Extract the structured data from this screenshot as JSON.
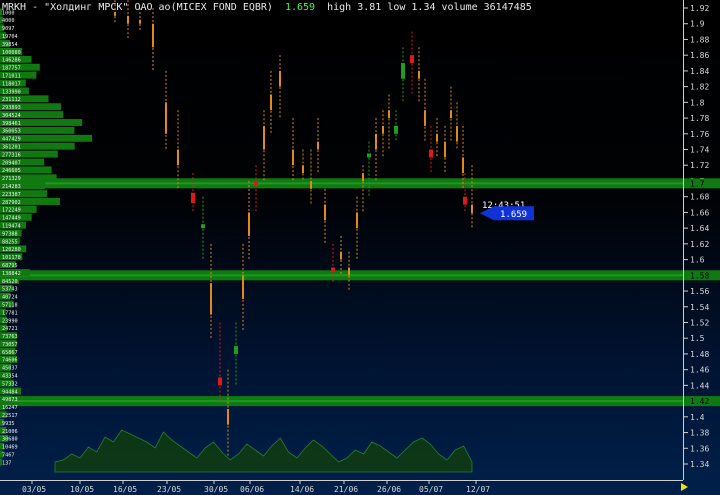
{
  "header": {
    "title": "MRKH - \"Холдинг МРСК\" ОАО ао(MICEX FOND EQBR)",
    "last": "1.659",
    "stats": "high 3.81  low 1.34  volume 36147485"
  },
  "chart_data": [
    {
      "type": "candlestick",
      "y_axis_labels": [
        "1.92",
        "1.9",
        "1.88",
        "1.86",
        "1.84",
        "1.82",
        "1.8",
        "1.78",
        "1.76",
        "1.74",
        "1.72",
        "1.7",
        "1.68",
        "1.66",
        "1.64",
        "1.62",
        "1.6",
        "1.58",
        "1.56",
        "1.54",
        "1.52",
        "1.5",
        "1.48",
        "1.46",
        "1.44",
        "1.42",
        "1.4",
        "1.38",
        "1.36",
        "1.34"
      ],
      "ylim": [
        1.333,
        1.925
      ],
      "x_tick_labels": [
        "03/05",
        "10/05",
        "16/05",
        "23/05",
        "30/05",
        "06/06",
        "14/06",
        "21/06",
        "26/06",
        "05/07",
        "12/07"
      ],
      "bars": [
        {
          "x": 115,
          "low": 1.9,
          "high": 1.93,
          "open": 1.915,
          "close": 1.91,
          "color": "orange"
        },
        {
          "x": 128,
          "low": 1.88,
          "high": 1.93,
          "open": 1.91,
          "close": 1.9,
          "color": "orange"
        },
        {
          "x": 140,
          "low": 1.89,
          "high": 1.92,
          "open": 1.905,
          "close": 1.9,
          "color": "orange"
        },
        {
          "x": 153,
          "low": 1.84,
          "high": 1.92,
          "open": 1.9,
          "close": 1.87,
          "color": "orange"
        },
        {
          "x": 166,
          "low": 1.74,
          "high": 1.84,
          "open": 1.8,
          "close": 1.76,
          "color": "orange"
        },
        {
          "x": 178,
          "low": 1.69,
          "high": 1.79,
          "open": 1.74,
          "close": 1.72,
          "color": "orange"
        },
        {
          "x": 193,
          "low": 1.66,
          "high": 1.71,
          "open": 1.685,
          "close": 1.672,
          "color": "red"
        },
        {
          "x": 203,
          "low": 1.6,
          "high": 1.68,
          "open": 1.645,
          "close": 1.64,
          "color": "green"
        },
        {
          "x": 211,
          "low": 1.5,
          "high": 1.62,
          "open": 1.57,
          "close": 1.53,
          "color": "orange"
        },
        {
          "x": 220,
          "low": 1.42,
          "high": 1.52,
          "open": 1.45,
          "close": 1.44,
          "color": "red"
        },
        {
          "x": 228,
          "low": 1.35,
          "high": 1.46,
          "open": 1.41,
          "close": 1.39,
          "color": "orange"
        },
        {
          "x": 236,
          "low": 1.44,
          "high": 1.52,
          "open": 1.48,
          "close": 1.49,
          "color": "green"
        },
        {
          "x": 243,
          "low": 1.51,
          "high": 1.62,
          "open": 1.55,
          "close": 1.58,
          "color": "orange"
        },
        {
          "x": 249,
          "low": 1.6,
          "high": 1.7,
          "open": 1.63,
          "close": 1.66,
          "color": "orange"
        },
        {
          "x": 256,
          "low": 1.66,
          "high": 1.72,
          "open": 1.7,
          "close": 1.694,
          "color": "red"
        },
        {
          "x": 264,
          "low": 1.7,
          "high": 1.79,
          "open": 1.74,
          "close": 1.77,
          "color": "orange"
        },
        {
          "x": 271,
          "low": 1.76,
          "high": 1.84,
          "open": 1.79,
          "close": 1.81,
          "color": "orange"
        },
        {
          "x": 280,
          "low": 1.78,
          "high": 1.86,
          "open": 1.82,
          "close": 1.84,
          "color": "orange"
        },
        {
          "x": 293,
          "low": 1.7,
          "high": 1.78,
          "open": 1.74,
          "close": 1.72,
          "color": "orange"
        },
        {
          "x": 303,
          "low": 1.7,
          "high": 1.74,
          "open": 1.72,
          "close": 1.71,
          "color": "orange"
        },
        {
          "x": 311,
          "low": 1.67,
          "high": 1.74,
          "open": 1.7,
          "close": 1.69,
          "color": "orange"
        },
        {
          "x": 318,
          "low": 1.71,
          "high": 1.78,
          "open": 1.74,
          "close": 1.75,
          "color": "orange"
        },
        {
          "x": 325,
          "low": 1.62,
          "high": 1.69,
          "open": 1.67,
          "close": 1.65,
          "color": "orange"
        },
        {
          "x": 333,
          "low": 1.57,
          "high": 1.62,
          "open": 1.59,
          "close": 1.585,
          "color": "red"
        },
        {
          "x": 341,
          "low": 1.58,
          "high": 1.63,
          "open": 1.6,
          "close": 1.61,
          "color": "orange"
        },
        {
          "x": 349,
          "low": 1.56,
          "high": 1.61,
          "open": 1.58,
          "close": 1.59,
          "color": "orange"
        },
        {
          "x": 357,
          "low": 1.6,
          "high": 1.68,
          "open": 1.64,
          "close": 1.66,
          "color": "orange"
        },
        {
          "x": 363,
          "low": 1.66,
          "high": 1.72,
          "open": 1.7,
          "close": 1.71,
          "color": "orange"
        },
        {
          "x": 369,
          "low": 1.68,
          "high": 1.75,
          "open": 1.73,
          "close": 1.735,
          "color": "green"
        },
        {
          "x": 376,
          "low": 1.7,
          "high": 1.78,
          "open": 1.74,
          "close": 1.76,
          "color": "orange"
        },
        {
          "x": 383,
          "low": 1.73,
          "high": 1.79,
          "open": 1.77,
          "close": 1.76,
          "color": "orange"
        },
        {
          "x": 389,
          "low": 1.74,
          "high": 1.81,
          "open": 1.78,
          "close": 1.79,
          "color": "orange"
        },
        {
          "x": 396,
          "low": 1.75,
          "high": 1.79,
          "open": 1.76,
          "close": 1.77,
          "color": "green"
        },
        {
          "x": 403,
          "low": 1.8,
          "high": 1.87,
          "open": 1.83,
          "close": 1.85,
          "color": "green"
        },
        {
          "x": 412,
          "low": 1.81,
          "high": 1.89,
          "open": 1.86,
          "close": 1.85,
          "color": "red"
        },
        {
          "x": 419,
          "low": 1.8,
          "high": 1.87,
          "open": 1.84,
          "close": 1.83,
          "color": "orange"
        },
        {
          "x": 425,
          "low": 1.75,
          "high": 1.83,
          "open": 1.79,
          "close": 1.77,
          "color": "orange"
        },
        {
          "x": 431,
          "low": 1.71,
          "high": 1.77,
          "open": 1.74,
          "close": 1.73,
          "color": "red"
        },
        {
          "x": 437,
          "low": 1.73,
          "high": 1.78,
          "open": 1.76,
          "close": 1.75,
          "color": "orange"
        },
        {
          "x": 445,
          "low": 1.71,
          "high": 1.77,
          "open": 1.75,
          "close": 1.73,
          "color": "orange"
        },
        {
          "x": 451,
          "low": 1.75,
          "high": 1.82,
          "open": 1.78,
          "close": 1.79,
          "color": "orange"
        },
        {
          "x": 457,
          "low": 1.74,
          "high": 1.8,
          "open": 1.77,
          "close": 1.75,
          "color": "orange"
        },
        {
          "x": 463,
          "low": 1.69,
          "high": 1.77,
          "open": 1.73,
          "close": 1.71,
          "color": "orange"
        },
        {
          "x": 465,
          "low": 1.66,
          "high": 1.71,
          "open": 1.68,
          "close": 1.67,
          "color": "red"
        },
        {
          "x": 472,
          "low": 1.64,
          "high": 1.72,
          "open": 1.67,
          "close": 1.659,
          "color": "orange"
        }
      ],
      "volume_profile": {
        "labels": [
          "1000",
          "4000",
          "9097",
          "19704",
          "39854",
          "100080",
          "146286",
          "187757",
          "171011",
          "118017",
          "133990",
          "231112",
          "293893",
          "304524",
          "398461",
          "360053",
          "447429",
          "361201",
          "277316",
          "209407",
          "246605",
          "271329",
          "214283",
          "223387",
          "287902",
          "172249",
          "147449",
          "119474",
          "97388",
          "88255",
          "120280",
          "101170",
          "68795",
          "138842",
          "84520",
          "53743",
          "40724",
          "57118",
          "17781",
          "23990",
          "24721",
          "73763",
          "73057",
          "65867",
          "74606",
          "45037",
          "43354",
          "57332",
          "94484",
          "49873",
          "16247",
          "22517",
          "9935",
          "21006",
          "30680",
          "10469",
          "7467",
          "137"
        ],
        "volumes": [
          1000,
          4000,
          9097,
          19704,
          39854,
          100080,
          146286,
          187757,
          171011,
          118017,
          133990,
          231112,
          293893,
          304524,
          398461,
          360053,
          447429,
          361201,
          277316,
          209407,
          246605,
          271329,
          214283,
          223387,
          287902,
          172249,
          147449,
          119474,
          97388,
          88255,
          120280,
          101170,
          68795,
          138842,
          84520,
          53743,
          40724,
          57118,
          17781,
          23990,
          24721,
          73763,
          73057,
          65867,
          74606,
          45037,
          43354,
          57332,
          94484,
          49873,
          16247,
          22517,
          9935,
          21006,
          30680,
          10469,
          7467,
          137
        ]
      },
      "levels": [
        {
          "price": 1.697,
          "label": "1.7"
        },
        {
          "price": 1.58,
          "label": "1.58"
        },
        {
          "price": 1.42,
          "label": "1.42"
        }
      ],
      "current": {
        "time": "12:43:51",
        "price": "1.659",
        "value": 1.659
      },
      "volume_area": [
        10,
        12,
        18,
        14,
        25,
        20,
        35,
        30,
        42,
        38,
        34,
        30,
        24,
        40,
        32,
        26,
        20,
        14,
        24,
        30,
        20,
        12,
        18,
        28,
        22,
        16,
        26,
        34,
        20,
        14,
        24,
        32,
        26,
        18,
        10,
        14,
        22,
        18,
        30,
        26,
        20,
        14,
        22,
        30,
        34,
        28,
        18,
        12,
        22,
        26,
        10
      ]
    }
  ]
}
